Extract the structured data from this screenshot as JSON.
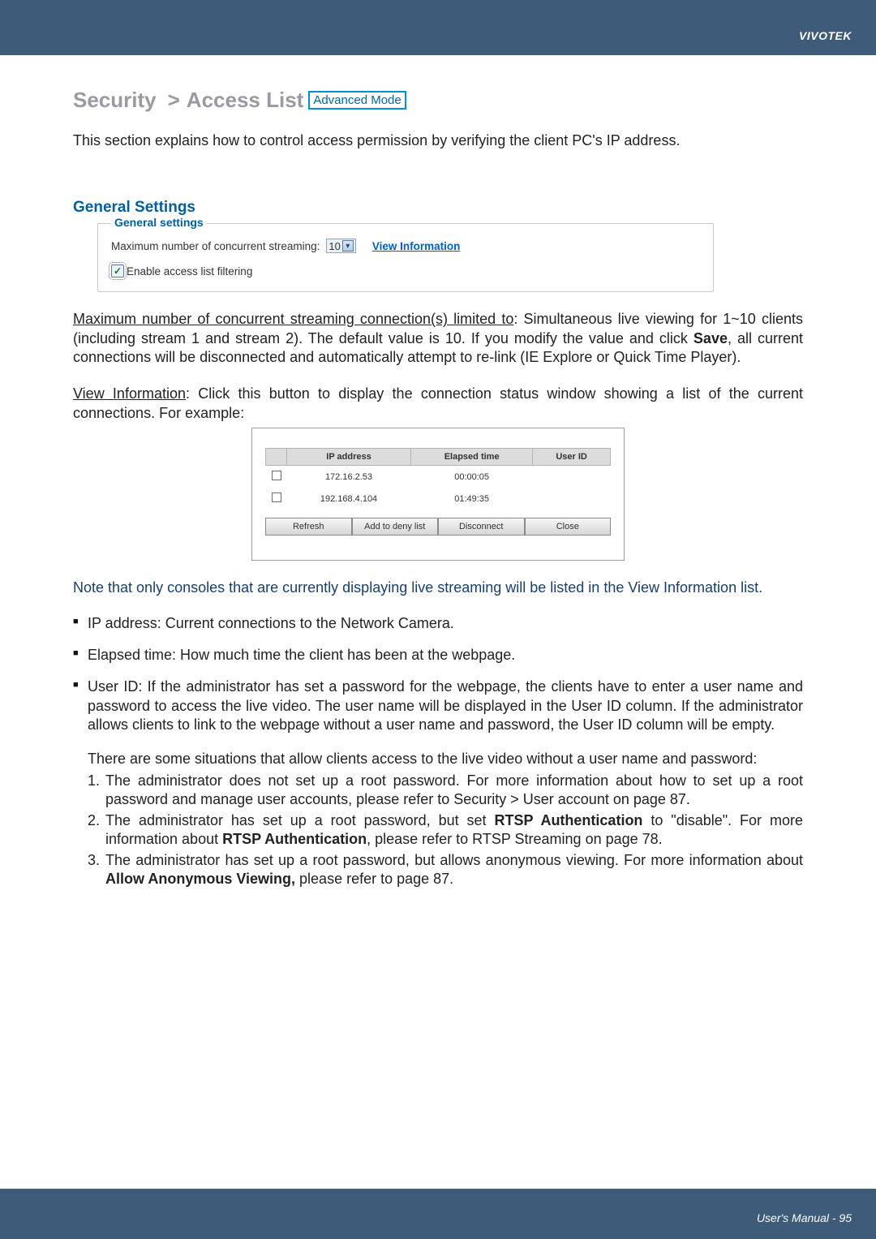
{
  "brand": "VIVOTEK",
  "title": {
    "sec": "Security",
    "gt": ">",
    "access_list": "Access List",
    "adv_mode": "Advanced Mode"
  },
  "intro": "This section explains how to control access permission by verifying the client PC's IP address.",
  "general_settings_heading": "General Settings",
  "gs_panel": {
    "legend": "General settings",
    "label_max": "Maximum number of concurrent streaming:",
    "select_value": "10",
    "view_info": "View Information",
    "enable_filter": "Enable access list filtering"
  },
  "para_max": {
    "uline": "Maximum number of concurrent streaming connection(s) limited to",
    "rest1": ": Simultaneous live viewing for 1~10 clients (including stream 1 and stream 2). The default value is 10. If you modify the value and click ",
    "bold_save": "Save",
    "rest2": ", all current connections will be disconnected and automatically attempt to re-link (IE Explore or Quick Time Player)."
  },
  "para_view": {
    "uline": "View Information",
    "rest": ": Click this button to display the connection status window showing a list of the current connections. For example:"
  },
  "conn_table": {
    "headers": {
      "ip": "IP address",
      "elapsed": "Elapsed time",
      "user": "User ID"
    },
    "rows": [
      {
        "ip": "172.16.2.53",
        "elapsed": "00:00:05",
        "user": ""
      },
      {
        "ip": "192.168.4.104",
        "elapsed": "01:49:35",
        "user": ""
      }
    ],
    "buttons": {
      "refresh": "Refresh",
      "deny": "Add to deny list",
      "disc": "Disconnect",
      "close": "Close"
    }
  },
  "note_navy": "Note that only consoles that are currently displaying live streaming will be listed in the View Information list.",
  "bullet_ip": "IP address: Current connections to the Network Camera.",
  "bullet_elapsed": "Elapsed time: How much time the client has been at the webpage.",
  "bullet_userid": "User ID: If the administrator has set a password for the webpage, the clients have to enter a user name and password to access the live video. The user name will be displayed in the User ID column. If  the administrator allows clients to link to the webpage without a user name and password, the User ID column will be empty.",
  "sub_para": "There are some situations that allow clients access to the live video without a user name and password:",
  "ol": {
    "i1": "The administrator does not set up a root password. For more information about how to set up a root password and manage user accounts, please refer to Security > User account on page 87.",
    "i2a": "The administrator has set up a root password, but set ",
    "i2b1": "RTSP Authentication",
    "i2c": " to \"disable\". For more information about ",
    "i2b2": "RTSP Authentication",
    "i2d": ", please refer to RTSP Streaming on page 78.",
    "i3a": "The administrator has set up a root password, but allows anonymous viewing. For more information about ",
    "i3b": "Allow Anonymous Viewing,",
    "i3c": " please refer to page 87."
  },
  "footer": "User's Manual - 95"
}
